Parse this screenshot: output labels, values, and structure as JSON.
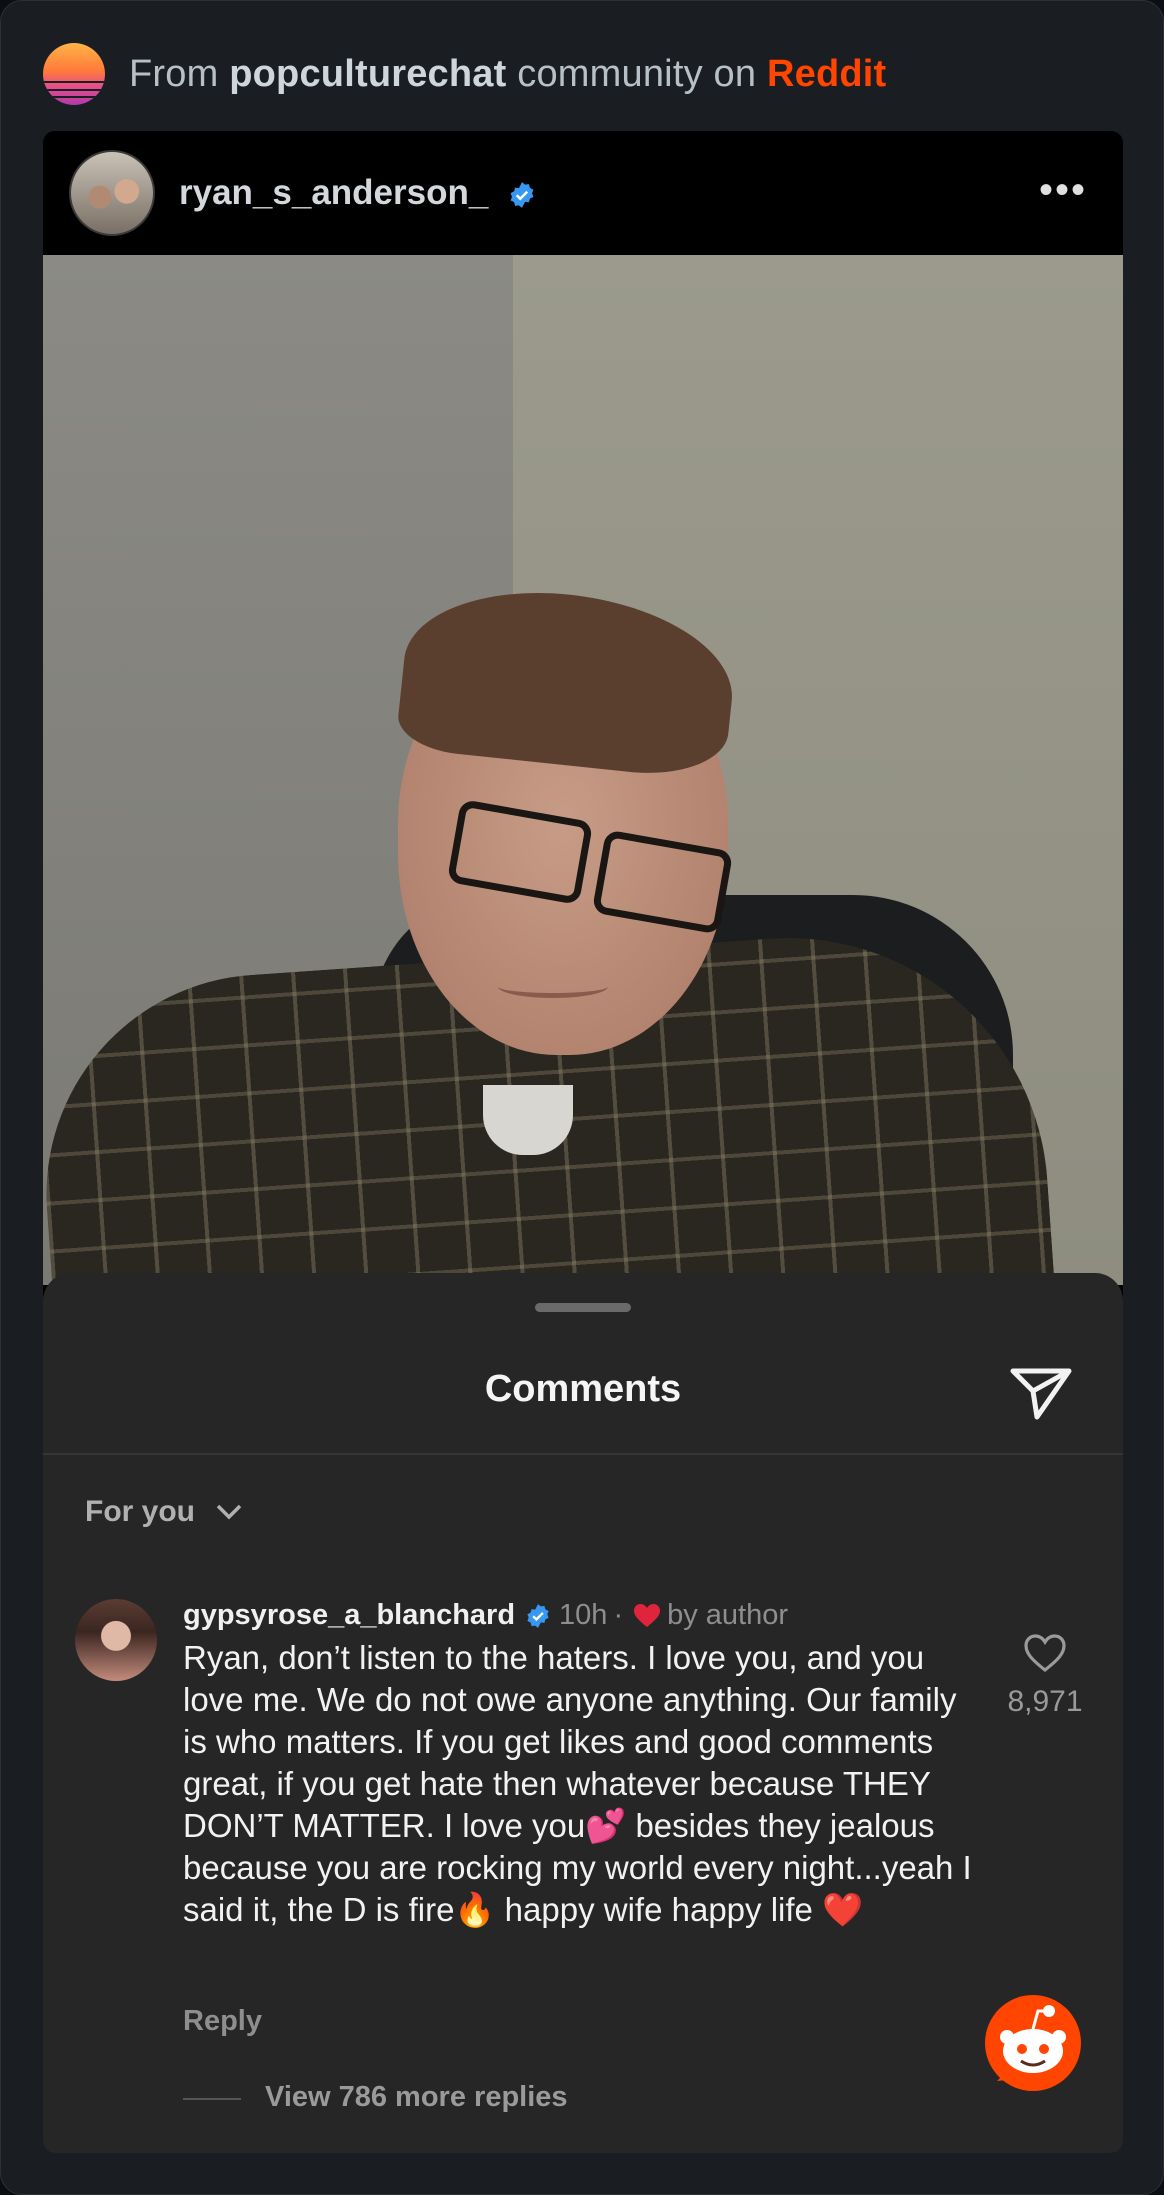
{
  "header": {
    "prefix": "From",
    "community": "popculturechat",
    "middle": "community on",
    "brand": "Reddit"
  },
  "post": {
    "username": "ryan_s_anderson_",
    "more_icon": "more-horizontal-icon",
    "verified_icon": "verified-badge-icon"
  },
  "comments_sheet": {
    "title": "Comments",
    "share_icon": "send-icon",
    "filter_label": "For you",
    "comment": {
      "username": "gypsyrose_a_blanchard",
      "time": "10h",
      "separator": "·",
      "liked_by": "by author",
      "body": "Ryan, don’t listen to the haters. I love you, and you love me. We do not owe anyone anything. Our family is who matters. If you get likes and good comments great, if you get hate then whatever because THEY DON’T MATTER. I love you💕 besides they jealous because you are rocking my world every night...yeah I said it, the D is fire🔥 happy wife happy life ❤️",
      "reply_label": "Reply",
      "like_count": "8,971",
      "view_replies": "View 786 more replies"
    }
  },
  "colors": {
    "reddit_orange": "#ff4500",
    "verified_blue": "#3897f0",
    "heart_red": "#e0243b"
  }
}
